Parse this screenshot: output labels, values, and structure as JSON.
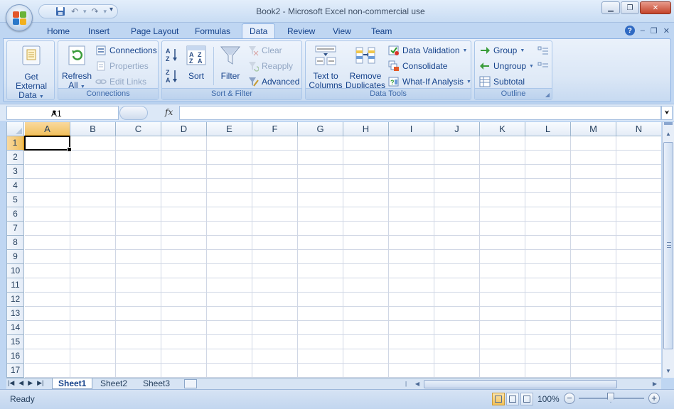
{
  "window": {
    "title": "Book2 - Microsoft Excel non-commercial use"
  },
  "ribbon_tabs": [
    "Home",
    "Insert",
    "Page Layout",
    "Formulas",
    "Data",
    "Review",
    "View",
    "Team"
  ],
  "active_tab": "Data",
  "groups": {
    "get_external": {
      "label_line1": "Get External",
      "label_line2": "Data"
    },
    "connections": {
      "label": "Connections",
      "refresh_line1": "Refresh",
      "refresh_line2": "All",
      "connections": "Connections",
      "properties": "Properties",
      "edit_links": "Edit Links"
    },
    "sort_filter": {
      "label": "Sort & Filter",
      "sort": "Sort",
      "filter": "Filter",
      "clear": "Clear",
      "reapply": "Reapply",
      "advanced": "Advanced"
    },
    "data_tools": {
      "label": "Data Tools",
      "text_to_columns_line1": "Text to",
      "text_to_columns_line2": "Columns",
      "remove_dup_line1": "Remove",
      "remove_dup_line2": "Duplicates",
      "data_validation": "Data Validation",
      "consolidate": "Consolidate",
      "what_if": "What-If Analysis"
    },
    "outline": {
      "label": "Outline",
      "group": "Group",
      "ungroup": "Ungroup",
      "subtotal": "Subtotal"
    }
  },
  "formula_bar": {
    "name_box": "A1",
    "fx": "fx",
    "value": ""
  },
  "grid": {
    "columns": [
      "A",
      "B",
      "C",
      "D",
      "E",
      "F",
      "G",
      "H",
      "I",
      "J",
      "K",
      "L",
      "M",
      "N"
    ],
    "rows": [
      "1",
      "2",
      "3",
      "4",
      "5",
      "6",
      "7",
      "8",
      "9",
      "10",
      "11",
      "12",
      "13",
      "14",
      "15",
      "16",
      "17"
    ],
    "selected_cell": "A1"
  },
  "sheets": [
    "Sheet1",
    "Sheet2",
    "Sheet3"
  ],
  "active_sheet": "Sheet1",
  "status": {
    "ready": "Ready",
    "zoom": "100%"
  },
  "colors": {
    "accent": "#15428b",
    "ribbon_bg": "#dbe7f6",
    "selection_header": "#f1c15f"
  }
}
